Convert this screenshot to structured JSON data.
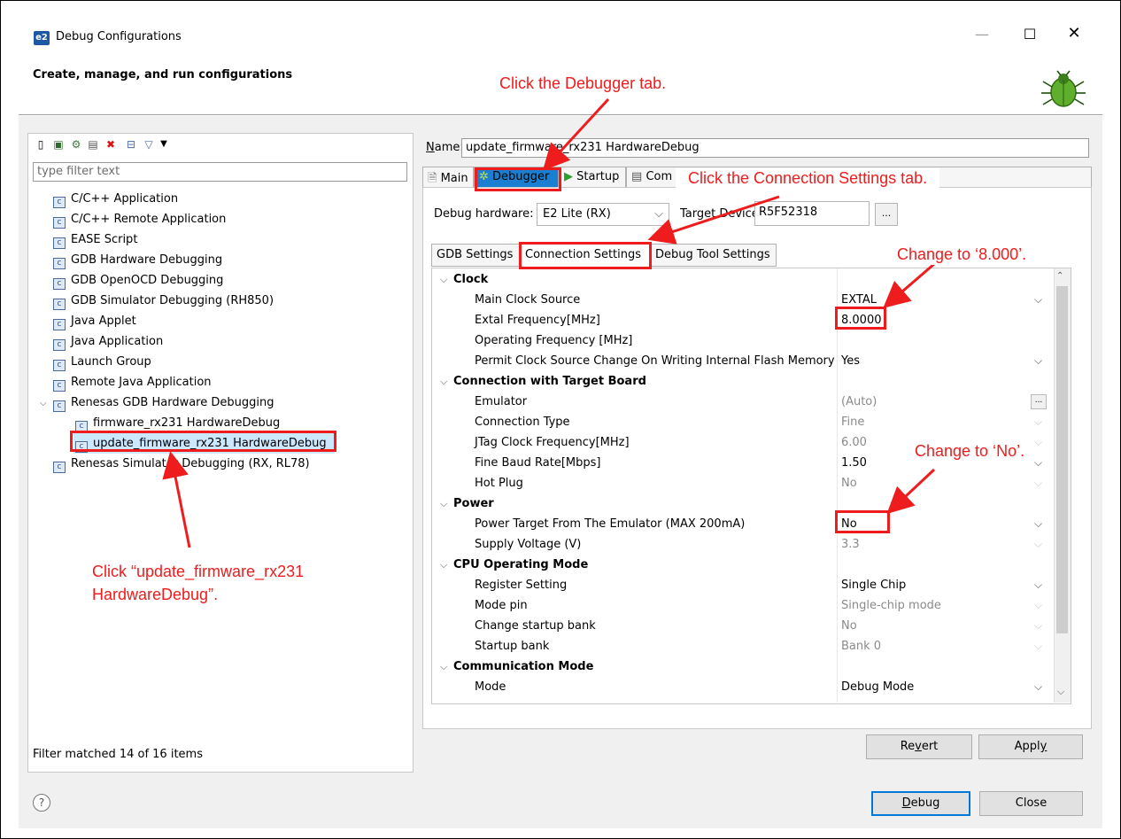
{
  "window": {
    "title": "Debug Configurations",
    "subtitle": "Create, manage, and run configurations",
    "app_icon": "e2",
    "minimize": "—",
    "maximize": "☐",
    "close": "✕"
  },
  "left_panel": {
    "filter_placeholder": "type filter text",
    "tree": [
      {
        "label": "C/C++ Application",
        "icon": "c-app-icon"
      },
      {
        "label": "C/C++ Remote Application",
        "icon": "c-app-icon"
      },
      {
        "label": "EASE Script",
        "icon": "script-icon"
      },
      {
        "label": "GDB Hardware Debugging",
        "icon": "c-app-icon"
      },
      {
        "label": "GDB OpenOCD Debugging",
        "icon": "c-app-icon"
      },
      {
        "label": "GDB Simulator Debugging (RH850)",
        "icon": "c-app-icon"
      },
      {
        "label": "Java Applet",
        "icon": "java-applet-icon"
      },
      {
        "label": "Java Application",
        "icon": "java-app-icon"
      },
      {
        "label": "Launch Group",
        "icon": "launch-group-icon"
      },
      {
        "label": "Remote Java Application",
        "icon": "remote-java-icon"
      },
      {
        "label": "Renesas GDB Hardware Debugging",
        "icon": "c-app-icon",
        "expanded": true
      },
      {
        "label": "firmware_rx231 HardwareDebug",
        "icon": "c-app-icon",
        "indent": 1
      },
      {
        "label": "update_firmware_rx231 HardwareDebug",
        "icon": "c-app-icon",
        "indent": 1,
        "selected": true
      },
      {
        "label": "Renesas Simulator Debugging (RX, RL78)",
        "icon": "c-app-icon"
      }
    ],
    "status": "Filter matched 14 of 16 items"
  },
  "right_panel": {
    "name_label": "Name:",
    "name_value": "update_firmware_rx231 HardwareDebug",
    "tabs": [
      "Main",
      "Debugger",
      "Startup",
      "Com"
    ],
    "selected_tab": "Debugger",
    "debug_hardware_label": "Debug hardware:",
    "debug_hardware_value": "E2 Lite (RX)",
    "target_device_label": "Target Device:",
    "target_device_value": "R5F52318",
    "ellipsis": "...",
    "subtabs": [
      "GDB Settings",
      "Connection Settings",
      "Debug Tool Settings"
    ],
    "selected_subtab": "Connection Settings",
    "properties": [
      {
        "type": "category",
        "label": "Clock"
      },
      {
        "label": "Main Clock Source",
        "value": "EXTAL",
        "dropdown": true
      },
      {
        "label": "Extal Frequency[MHz]",
        "value": "8.0000"
      },
      {
        "label": "Operating Frequency [MHz]",
        "value": ""
      },
      {
        "label": "Permit Clock Source Change On Writing Internal Flash Memory",
        "value": "Yes",
        "dropdown": true
      },
      {
        "type": "category",
        "label": "Connection with Target Board"
      },
      {
        "label": "Emulator",
        "value": "(Auto)",
        "disabled": true,
        "browse": true
      },
      {
        "label": "Connection Type",
        "value": "Fine",
        "disabled": true,
        "dropdown": true
      },
      {
        "label": "JTag Clock Frequency[MHz]",
        "value": "6.00",
        "disabled": true,
        "dropdown": true
      },
      {
        "label": "Fine Baud Rate[Mbps]",
        "value": "1.50",
        "dropdown": true
      },
      {
        "label": "Hot Plug",
        "value": "No",
        "disabled": true,
        "dropdown": true
      },
      {
        "type": "category",
        "label": "Power"
      },
      {
        "label": "Power Target From The Emulator (MAX 200mA)",
        "value": "No",
        "dropdown": true
      },
      {
        "label": "Supply Voltage (V)",
        "value": "3.3",
        "disabled": true,
        "dropdown": true
      },
      {
        "type": "category",
        "label": "CPU Operating Mode"
      },
      {
        "label": "Register Setting",
        "value": "Single Chip",
        "dropdown": true
      },
      {
        "label": "Mode pin",
        "value": "Single-chip mode",
        "disabled": true,
        "dropdown": true
      },
      {
        "label": "Change startup bank",
        "value": "No",
        "disabled": true,
        "dropdown": true
      },
      {
        "label": "Startup bank",
        "value": "Bank 0",
        "disabled": true,
        "dropdown": true
      },
      {
        "type": "category",
        "label": "Communication Mode"
      },
      {
        "label": "Mode",
        "value": "Debug Mode",
        "dropdown": true
      }
    ],
    "revert_label": "Revert",
    "apply_label": "Apply"
  },
  "footer": {
    "help": "?",
    "debug_label": "Debug",
    "close_label": "Close"
  },
  "annotations": {
    "debugger_tab": "Click the Debugger tab.",
    "connection_tab": "Click the Connection Settings tab.",
    "extal": "Change to ‘8.000’.",
    "power": "Change to ‘No’.",
    "tree_line1": "Click “update_firmware_rx231",
    "tree_line2": "HardwareDebug”.",
    "color": "#ee1c1c"
  }
}
